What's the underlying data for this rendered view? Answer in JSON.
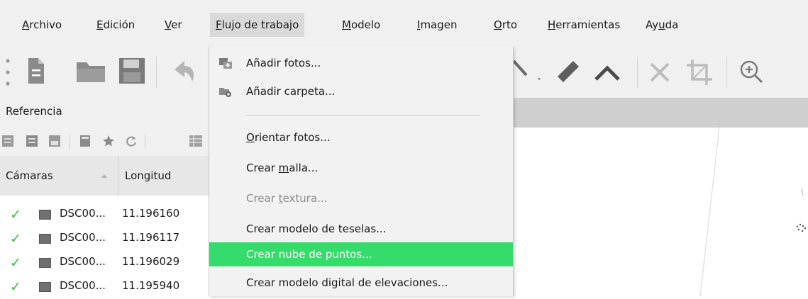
{
  "menubar": {
    "items": [
      {
        "pre": "",
        "acc": "A",
        "post": "rchivo"
      },
      {
        "pre": "",
        "acc": "E",
        "post": "dición"
      },
      {
        "pre": "",
        "acc": "V",
        "post": "er"
      },
      {
        "pre": "",
        "acc": "F",
        "post": "lujo de trabajo"
      },
      {
        "pre": "",
        "acc": "M",
        "post": "odelo"
      },
      {
        "pre": "",
        "acc": "I",
        "post": "magen"
      },
      {
        "pre": "",
        "acc": "O",
        "post": "rto"
      },
      {
        "pre": "",
        "acc": "H",
        "post": "erramientas"
      },
      {
        "pre": "Ay",
        "acc": "u",
        "post": "da"
      }
    ]
  },
  "toolbar": {
    "icons": [
      "drag-handle-icon",
      "new-document-icon",
      "open-folder-icon",
      "save-icon",
      "undo-icon",
      "pointer-icon",
      "ruler-icon",
      "chevron-up-icon",
      "delete-icon",
      "crop-icon",
      "zoom-in-icon"
    ]
  },
  "left_panel": {
    "title": "Referencia",
    "columns": {
      "camera": "Cámaras",
      "longitude": "Longitud"
    },
    "rows": [
      {
        "name": "DSC00...",
        "longitude": "11.196160"
      },
      {
        "name": "DSC00...",
        "longitude": "11.196117"
      },
      {
        "name": "DSC00...",
        "longitude": "11.196029"
      },
      {
        "name": "DSC00...",
        "longitude": "11.195940"
      }
    ]
  },
  "dropdown": {
    "items": [
      {
        "pre": "Añadir fotos...",
        "acc": "",
        "post": ""
      },
      {
        "pre": "Añadir carpeta...",
        "acc": "",
        "post": ""
      },
      {
        "pre": "",
        "acc": "O",
        "post": "rientar fotos..."
      },
      {
        "pre": "Crear ",
        "acc": "m",
        "post": "alla..."
      },
      {
        "pre": "Crear ",
        "acc": "t",
        "post": "extura..."
      },
      {
        "pre": "Crear modelo de teselas...",
        "acc": "",
        "post": ""
      },
      {
        "pre": "Crear nube de puntos...",
        "acc": "",
        "post": ""
      },
      {
        "pre": "Crear modelo digital de elevaciones...",
        "acc": "",
        "post": ""
      }
    ]
  },
  "colors": {
    "highlight": "#35dc6b",
    "check": "#2fbf3a"
  }
}
